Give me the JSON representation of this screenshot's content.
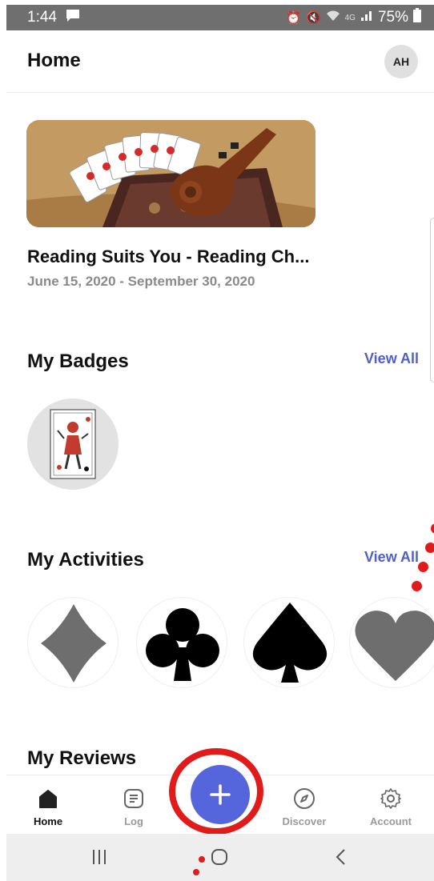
{
  "status_bar": {
    "time": "1:44",
    "battery": "75%",
    "icons": [
      "message-icon",
      "alarm-icon",
      "mute-icon",
      "wifi-icon",
      "lte-icon",
      "signal-icon",
      "battery-icon"
    ]
  },
  "header": {
    "title": "Home",
    "avatar_initials": "AH"
  },
  "challenge": {
    "title": "Reading Suits You - Reading Ch...",
    "dates": "June 15, 2020 - September 30, 2020"
  },
  "badges": {
    "title": "My Badges",
    "view_all": "View All",
    "items": [
      {
        "icon": "joker-card-icon"
      }
    ]
  },
  "activities": {
    "title": "My Activities",
    "view_all": "View All",
    "items": [
      {
        "icon": "diamond-icon",
        "color": "#6e6e6e"
      },
      {
        "icon": "club-icon",
        "color": "#000000"
      },
      {
        "icon": "spade-icon",
        "color": "#000000"
      },
      {
        "icon": "heart-icon",
        "color": "#6e6e6e"
      }
    ]
  },
  "reviews": {
    "title": "My Reviews"
  },
  "bottom_nav": {
    "items": [
      {
        "label": "Home",
        "icon": "home-icon",
        "active": true
      },
      {
        "label": "Log",
        "icon": "log-icon",
        "active": false
      },
      {
        "label": "Discover",
        "icon": "compass-icon",
        "active": false
      },
      {
        "label": "Account",
        "icon": "gear-icon",
        "active": false
      }
    ],
    "add_icon": "plus-icon"
  },
  "colors": {
    "accent": "#5565db",
    "link": "#5060c8",
    "annotation": "#e11a1a",
    "status_bar": "#6f6f6f"
  }
}
